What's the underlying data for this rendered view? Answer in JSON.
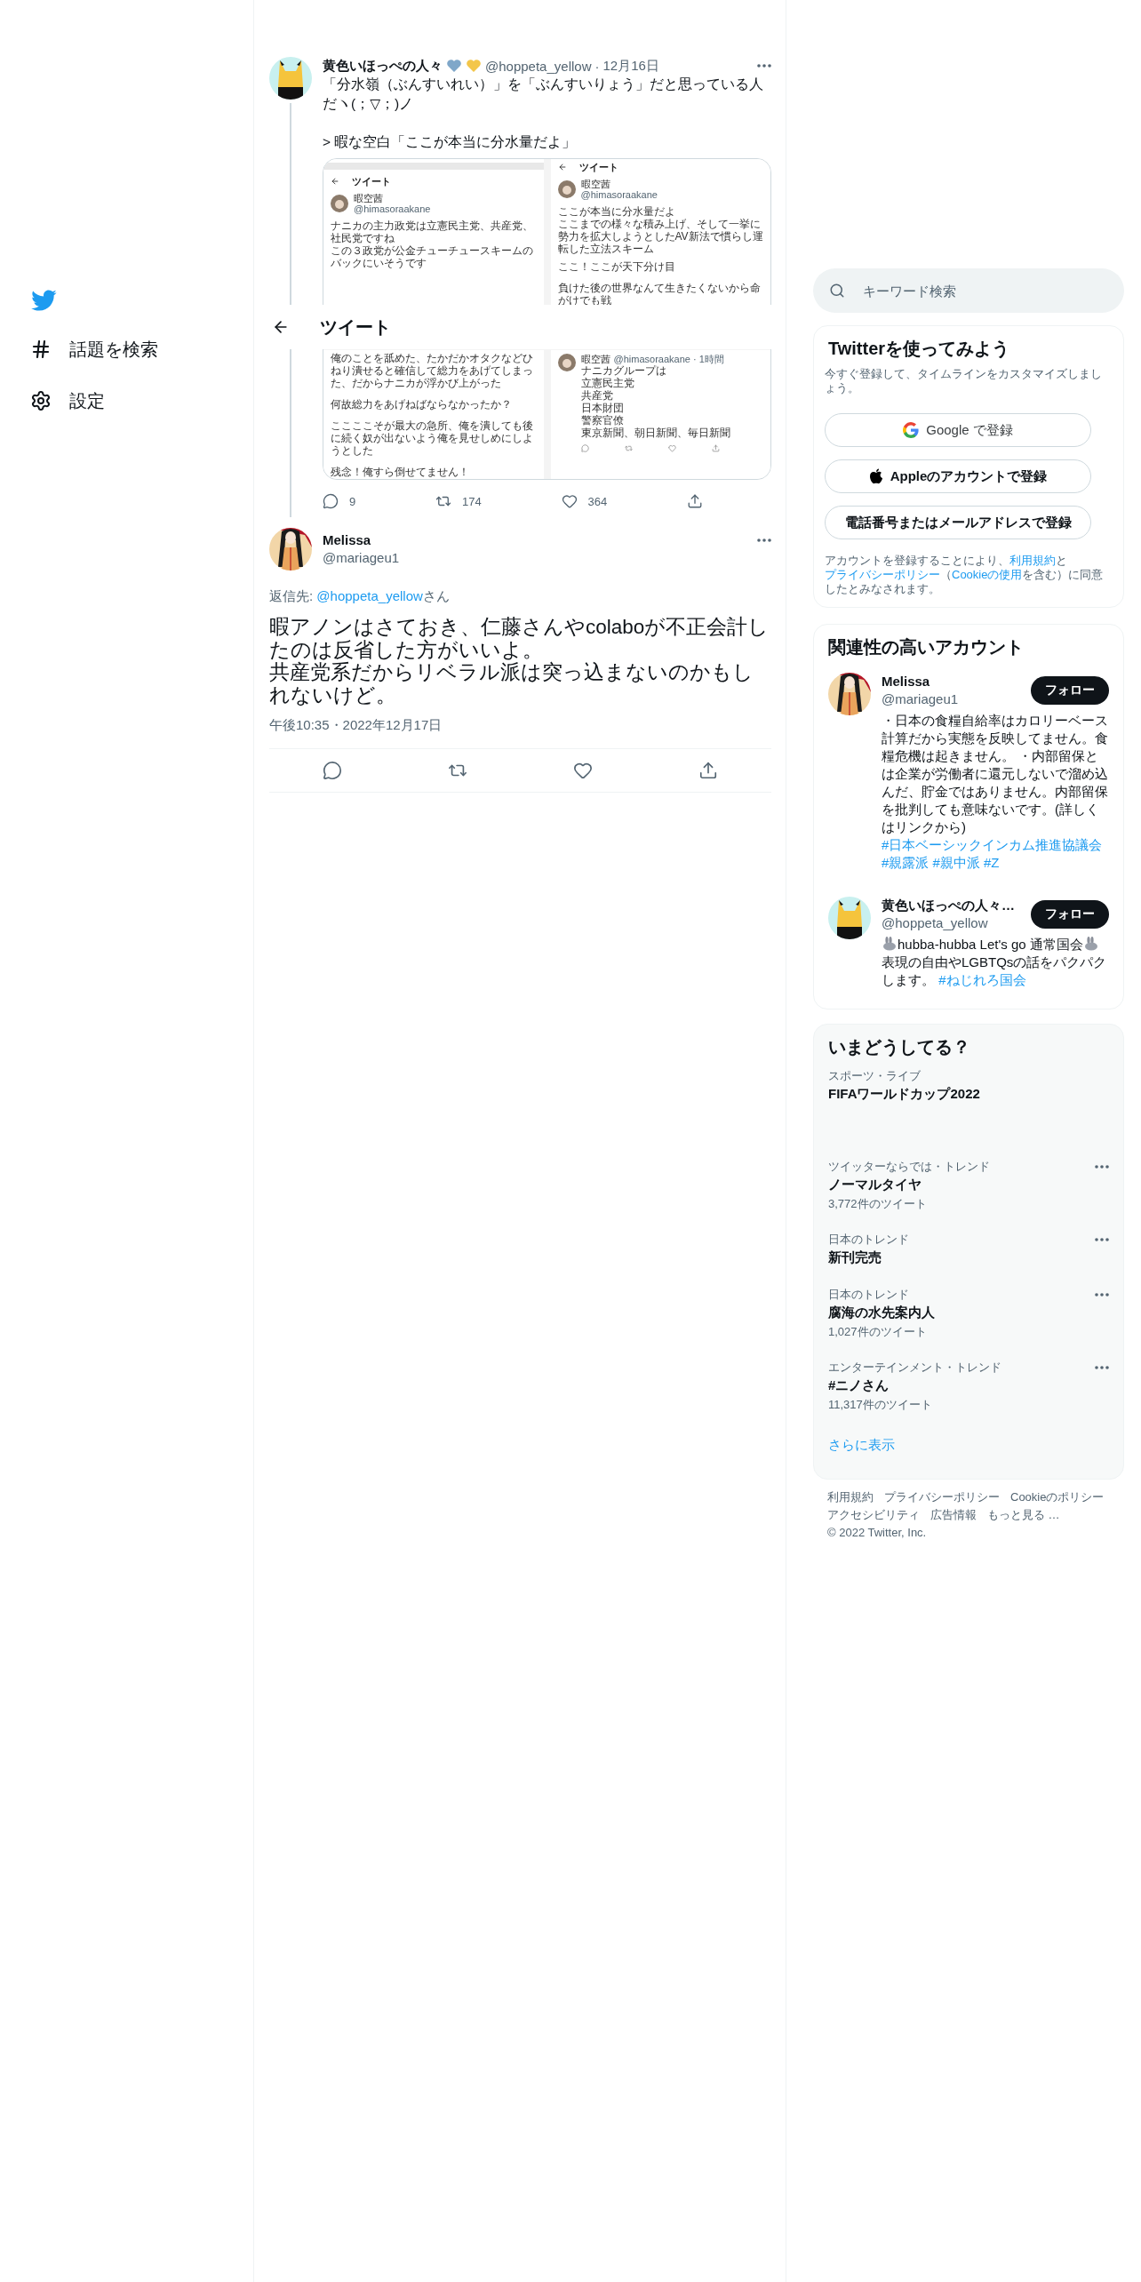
{
  "nav": {
    "items": [
      {
        "kind": "hash",
        "label": "話題を検索"
      },
      {
        "kind": "gear",
        "label": "設定"
      }
    ]
  },
  "header": {
    "title": "ツイート"
  },
  "thread_tweet": {
    "name": "黄色いほっぺの人々",
    "handle": "@hoppeta_yellow",
    "separator": "·",
    "date": "12月16日",
    "paragraphs": [
      "「分水嶺（ぶんすいれい）」を「ぶんすいりょう」だと思っている人だヽ(；▽；)ノ",
      "> 暇な空白「ここが本当に分水量だよ」"
    ],
    "attached_image": {
      "left_top": {
        "header": "ツイート",
        "name": "暇空茜",
        "handle": "@himasoraakane",
        "lines": [
          "ナニカの主力政党は立憲民主党、共産党、社民党ですね",
          "この３政党が公金チューチュースキームのバックにいそうです"
        ]
      },
      "left_bottom": {
        "lines": [
          "俺のことを舐めた、たかだかオタクなどひねり潰せると確信して総力をあげてしまった、だからナニカが浮かび上がった",
          "何故総力をあげねばならなかったか？",
          "ここここそが最大の急所、俺を潰しても後に続く奴が出ないよう俺を見せしめにしようとした",
          "残念！俺すら倒せてません！"
        ]
      },
      "right_top": {
        "header": "ツイート",
        "name": "暇空茜",
        "handle": "@himasoraakane",
        "lines": [
          "ここが本当に分水量だよ",
          "ここまでの様々な積み上げ、そして一挙に勢力を拡大しようとしたAV新法で慣らし運転した立法スキーム",
          "ここ！ここが天下分け目",
          "負けた後の世界なんて生きたくないから命がけでも戦"
        ]
      },
      "right_bottom": {
        "name": "暇空茜",
        "handle": "@himasoraakane · 1時間",
        "lines": [
          "ナニカグループは",
          "立憲民主党",
          "共産党",
          "日本財団",
          "警察官僚",
          "東京新聞、朝日新聞、毎日新聞"
        ]
      }
    },
    "stats": [
      {
        "kind": "reply",
        "count": "9"
      },
      {
        "kind": "retweet",
        "count": "174"
      },
      {
        "kind": "like",
        "count": "364"
      },
      {
        "kind": "share"
      }
    ]
  },
  "main_tweet": {
    "name": "Melissa",
    "handle": "@mariageu1",
    "reply_prefix": "返信先: ",
    "reply_to": "@hoppeta_yellow",
    "reply_suffix": "さん",
    "lines": [
      "暇アノンはさておき、仁藤さんやcolaboが不正会計したのは反省した方がいいよ。",
      "共産党系だからリベラル派は突っ込まないのかもしれないけど。"
    ],
    "timestamp": "午後10:35・2022年12月17日",
    "actions": [
      {
        "kind": "reply"
      },
      {
        "kind": "retweet"
      },
      {
        "kind": "like"
      },
      {
        "kind": "share"
      }
    ]
  },
  "search": {
    "placeholder": "キーワード検索"
  },
  "signup": {
    "title": "Twitterを使ってみよう",
    "subtitle": "今すぐ登録して、タイムラインをカスタマイズしましょう。",
    "buttons": [
      {
        "kind": "google",
        "label": "Google で登録"
      },
      {
        "kind": "apple",
        "label": "Appleのアカウントで登録"
      },
      {
        "kind": "phone",
        "label": "電話番号またはメールアドレスで登録"
      }
    ],
    "legal": [
      {
        "kind": "text",
        "text": "アカウントを登録することにより、"
      },
      {
        "kind": "link",
        "text": "利用規約"
      },
      {
        "kind": "text",
        "text": "と"
      },
      {
        "kind": "link",
        "text": "プライバシーポリシー"
      },
      {
        "kind": "text",
        "text": "（"
      },
      {
        "kind": "link",
        "text": "Cookieの使用"
      },
      {
        "kind": "text",
        "text": "を含む）に同意したとみなされます。"
      }
    ]
  },
  "related": {
    "title": "関連性の高いアカウント",
    "accounts": [
      {
        "kind": "girl",
        "name": "Melissa",
        "handle": "@mariageu1",
        "follow": "フォロー",
        "bio": [
          {
            "kind": "text",
            "text": "・日本の食糧自給率はカロリーベース計算だから実態を反映してません。食糧危機は起きません。 ・内部留保とは企業が労働者に還元しないで溜め込んだ、貯金ではありません。内部留保を批判しても意味ないです。(詳しくはリンクから) "
          },
          {
            "kind": "hashtag",
            "text": "#日本ベーシックインカム推進協議会"
          },
          {
            "kind": "hashtag",
            "text": "#親露派"
          },
          {
            "kind": "hashtag",
            "text": "#親中派"
          },
          {
            "kind": "hashtag",
            "text": "#Z"
          }
        ]
      },
      {
        "kind": "yellow",
        "name": "黄色いほっぺの人々…",
        "handle": "@hoppeta_yellow",
        "follow": "フォロー",
        "bio": [
          {
            "kind": "rabbit"
          },
          {
            "kind": "text",
            "text": "hubba-hubba Let's go 通常国会"
          },
          {
            "kind": "rabbit"
          },
          {
            "kind": "text",
            "text": "表現の自由やLGBTQsの話をパクパクします。 "
          },
          {
            "kind": "hashtag",
            "text": "#ねじれろ国会"
          }
        ]
      }
    ]
  },
  "trends": {
    "title": "いまどうしてる？",
    "items": [
      {
        "kind": "event",
        "context": "スポーツ・ライブ",
        "topic": "FIFAワールドカップ2022"
      },
      {
        "kind": "trend",
        "context": "ツイッターならでは・トレンド",
        "topic": "ノーマルタイヤ",
        "count": "3,772件のツイート"
      },
      {
        "kind": "trend",
        "context": "日本のトレンド",
        "topic": "新刊完売"
      },
      {
        "kind": "trend",
        "context": "日本のトレンド",
        "topic": "腐海の水先案内人",
        "count": "1,027件のツイート"
      },
      {
        "kind": "trend",
        "context": "エンターテインメント・トレンド",
        "topic": "#ニノさん",
        "count": "11,317件のツイート"
      }
    ],
    "show_more": "さらに表示"
  },
  "footer": {
    "links": [
      "利用規約",
      "プライバシーポリシー",
      "Cookieのポリシー",
      "アクセシビリティ",
      "広告情報",
      "もっと見る …"
    ],
    "copyright": "© 2022 Twitter, Inc."
  }
}
